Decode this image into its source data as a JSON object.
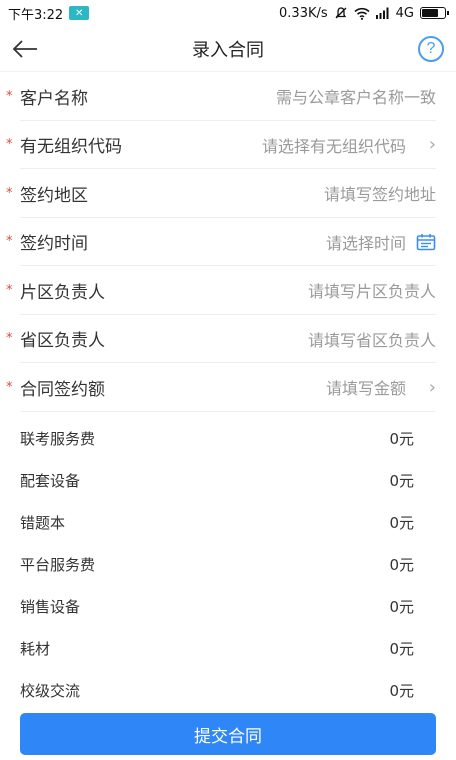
{
  "status_bar": {
    "time": "下午3:22",
    "network_speed": "0.33K/s",
    "signal": "4G",
    "battery_level": 0.8
  },
  "header": {
    "title": "录入合同",
    "back_icon": "back-arrow-icon",
    "help_icon": "help-icon",
    "help_symbol": "?"
  },
  "form": {
    "fields": [
      {
        "required": "*",
        "label": "客户名称",
        "placeholder": "需与公章客户名称一致",
        "trail": "none"
      },
      {
        "required": "*",
        "label": "有无组织代码",
        "placeholder": "请选择有无组织代码",
        "trail": "chevron"
      },
      {
        "required": "*",
        "label": "签约地区",
        "placeholder": "请填写签约地址",
        "trail": "none"
      },
      {
        "required": "*",
        "label": "签约时间",
        "placeholder": "请选择时间",
        "trail": "calendar"
      },
      {
        "required": "*",
        "label": "片区负责人",
        "placeholder": "请填写片区负责人",
        "trail": "none"
      },
      {
        "required": "*",
        "label": "省区负责人",
        "placeholder": "请填写省区负责人",
        "trail": "none"
      },
      {
        "required": "*",
        "label": "合同签约额",
        "placeholder": "请填写金额",
        "trail": "chevron"
      }
    ],
    "chevron_symbol": "›"
  },
  "fees": [
    {
      "label": "联考服务费",
      "value": "0元"
    },
    {
      "label": "配套设备",
      "value": "0元"
    },
    {
      "label": "错题本",
      "value": "0元"
    },
    {
      "label": "平台服务费",
      "value": "0元"
    },
    {
      "label": "销售设备",
      "value": "0元"
    },
    {
      "label": "耗材",
      "value": "0元"
    },
    {
      "label": "校级交流",
      "value": "0元"
    }
  ],
  "submit_label": "提交合同",
  "colors": {
    "accent": "#2f86f6",
    "required": "#e04a3a",
    "help": "#4a9df0"
  }
}
